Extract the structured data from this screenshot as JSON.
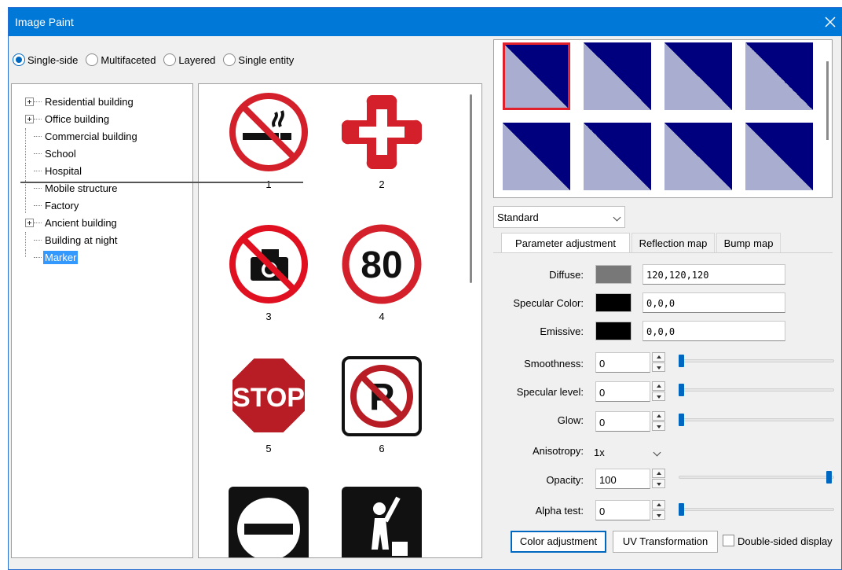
{
  "window": {
    "title": "Image Paint"
  },
  "mode_options": [
    {
      "label": "Single-side",
      "selected": true
    },
    {
      "label": "Multifaceted",
      "selected": false
    },
    {
      "label": "Layered",
      "selected": false
    },
    {
      "label": "Single entity",
      "selected": false
    }
  ],
  "tree": {
    "items": [
      {
        "label": "Residential building",
        "expandable": true,
        "selected": false
      },
      {
        "label": "Office building",
        "expandable": true,
        "selected": false
      },
      {
        "label": "Commercial building",
        "expandable": false,
        "selected": false
      },
      {
        "label": "School",
        "expandable": false,
        "selected": false
      },
      {
        "label": "Hospital",
        "expandable": false,
        "selected": false
      },
      {
        "label": "Mobile structure",
        "expandable": false,
        "selected": false
      },
      {
        "label": "Factory",
        "expandable": false,
        "selected": false
      },
      {
        "label": "Ancient building",
        "expandable": true,
        "selected": false
      },
      {
        "label": "Building at night",
        "expandable": false,
        "selected": false
      },
      {
        "label": "Marker",
        "expandable": false,
        "selected": true
      }
    ]
  },
  "gallery": {
    "items": [
      {
        "number": "1",
        "icon": "no-smoking-sign-icon"
      },
      {
        "number": "2",
        "icon": "red-cross-sign-icon"
      },
      {
        "number": "3",
        "icon": "no-photography-sign-icon"
      },
      {
        "number": "4",
        "icon": "speed-limit-80-sign-icon",
        "text": "80"
      },
      {
        "number": "5",
        "icon": "stop-sign-icon",
        "text": "STOP"
      },
      {
        "number": "6",
        "icon": "no-parking-sign-icon",
        "text": "P"
      },
      {
        "number": "",
        "icon": "no-entry-sign-icon"
      },
      {
        "number": "",
        "icon": "passenger-hailing-sign-icon"
      }
    ]
  },
  "preview": {
    "swatch_count": 8,
    "selected_index": 0,
    "colors": {
      "dark": "#00007f",
      "light": "#a9aed0"
    }
  },
  "material": {
    "type_value": "Standard"
  },
  "tabs": [
    "Parameter adjustment",
    "Reflection map",
    "Bump map"
  ],
  "params": {
    "diffuse": {
      "label": "Diffuse:",
      "value": "120,120,120",
      "color": "#787878"
    },
    "specular": {
      "label": "Specular Color:",
      "value": "0,0,0",
      "color": "#000000"
    },
    "emissive": {
      "label": "Emissive:",
      "value": "0,0,0",
      "color": "#000000"
    },
    "smoothness": {
      "label": "Smoothness:",
      "value": "0",
      "level": 0
    },
    "specular_level": {
      "label": "Specular level:",
      "value": "0",
      "level": 0
    },
    "glow": {
      "label": "Glow:",
      "value": "0",
      "level": 0
    },
    "anisotropy": {
      "label": "Anisotropy:",
      "value": "1x"
    },
    "opacity": {
      "label": "Opacity:",
      "value": "100",
      "level": 100
    },
    "alpha_test": {
      "label": "Alpha test:",
      "value": "0",
      "level": 0
    }
  },
  "buttons": {
    "color_adjustment": "Color adjustment",
    "uv_transformation": "UV Transformation",
    "double_sided": "Double-sided display"
  }
}
